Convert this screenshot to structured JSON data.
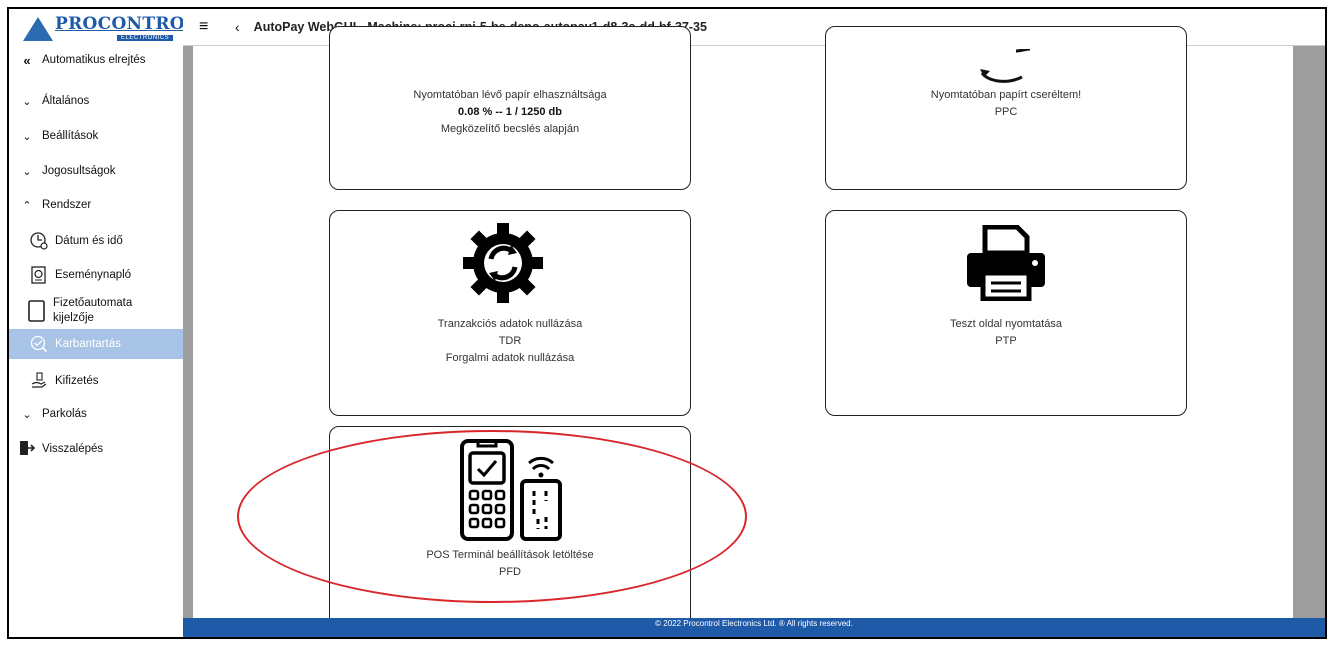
{
  "logo": {
    "brand": "PROCONTROL",
    "sub": "ELECTRONICS"
  },
  "header": {
    "title": "AutoPay WebGUI - Machine: proci-rpi-5-be-depo-autopay1-d8-3a-dd-bf-37-35"
  },
  "sidebar": {
    "hide_label": "Automatikus elrejtés",
    "groups": [
      {
        "label": "Általános"
      },
      {
        "label": "Beállítások"
      },
      {
        "label": "Jogosultságok"
      },
      {
        "label": "Rendszer"
      }
    ],
    "sub_items": [
      {
        "label": "Dátum és idő"
      },
      {
        "label": "Eseménynapló"
      },
      {
        "label": "Fizetőautomata kijelzője"
      },
      {
        "label": "Karbantartás"
      },
      {
        "label": "Kifizetés"
      }
    ],
    "parking": "Parkolás",
    "logout": "Visszalépés"
  },
  "cards": {
    "paper_usage": {
      "title": "Nyomtatóban lévő papír elhasználtsága",
      "value": "0.08 % -- 1 / 1250 db",
      "note": "Megközelítő becslés alapján"
    },
    "paper_changed": {
      "title": "Nyomtatóban papírt cseréltem!",
      "code": "PPC"
    },
    "tdr": {
      "title": "Tranzakciós adatok nullázása",
      "code": "TDR",
      "note": "Forgalmi adatok nullázása"
    },
    "ptp": {
      "title": "Teszt oldal nyomtatása",
      "code": "PTP"
    },
    "pfd": {
      "title": "POS Terminál beállítások letöltése",
      "code": "PFD"
    }
  },
  "footer": {
    "copyright": "© 2022 Procontrol Electronics Ltd. ® All rights reserved."
  },
  "colors": {
    "brand": "#1e5aa8",
    "active_item": "#a7c3e6",
    "highlight": "#d8262b",
    "gutter": "#9e9e9e"
  }
}
